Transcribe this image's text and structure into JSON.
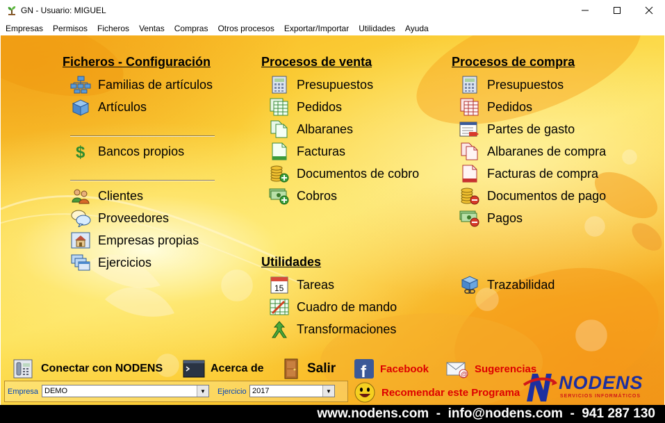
{
  "window": {
    "title": "GN - Usuario: MIGUEL"
  },
  "menu": [
    "Empresas",
    "Permisos",
    "Ficheros",
    "Ventas",
    "Compras",
    "Otros procesos",
    "Exportar/Importar",
    "Utilidades",
    "Ayuda"
  ],
  "sections": {
    "ficheros": {
      "title": "Ficheros - Configuración",
      "items": [
        "Familias de artículos",
        "Artículos",
        "Bancos propios",
        "Clientes",
        "Proveedores",
        "Empresas propias",
        "Ejercicios"
      ]
    },
    "venta": {
      "title": "Procesos de venta",
      "items": [
        "Presupuestos",
        "Pedidos",
        "Albaranes",
        "Facturas",
        "Documentos de cobro",
        "Cobros"
      ]
    },
    "compra": {
      "title": "Procesos de compra",
      "items": [
        "Presupuestos",
        "Pedidos",
        "Partes de gasto",
        "Albaranes de compra",
        "Facturas de compra",
        "Documentos de pago",
        "Pagos"
      ]
    },
    "utilidades": {
      "title": "Utilidades",
      "items": [
        "Tareas",
        "Cuadro de mando",
        "Transformaciones"
      ]
    },
    "trazabilidad": "Trazabilidad"
  },
  "bottom": {
    "conectar": "Conectar con NODENS",
    "acerca": "Acerca de",
    "salir": "Salir",
    "facebook": "Facebook",
    "sugerencias": "Sugerencias",
    "recomendar": "Recomendar este Programa"
  },
  "panel": {
    "empresa_label": "Empresa",
    "empresa_value": "DEMO",
    "ejercicio_label": "Ejercicio",
    "ejercicio_value": "2017"
  },
  "calendar_day": "15",
  "logo": {
    "name": "NODENS",
    "tagline": "SERVICIOS INFORMÁTICOS"
  },
  "footer": "www.nodens.com  -  info@nodens.com  -  941 287 130",
  "colors": {
    "section_bg": "#fbd13a",
    "link_red": "#dd0000",
    "footer_bg": "#000000",
    "logo_blue": "#1c2fa0"
  }
}
